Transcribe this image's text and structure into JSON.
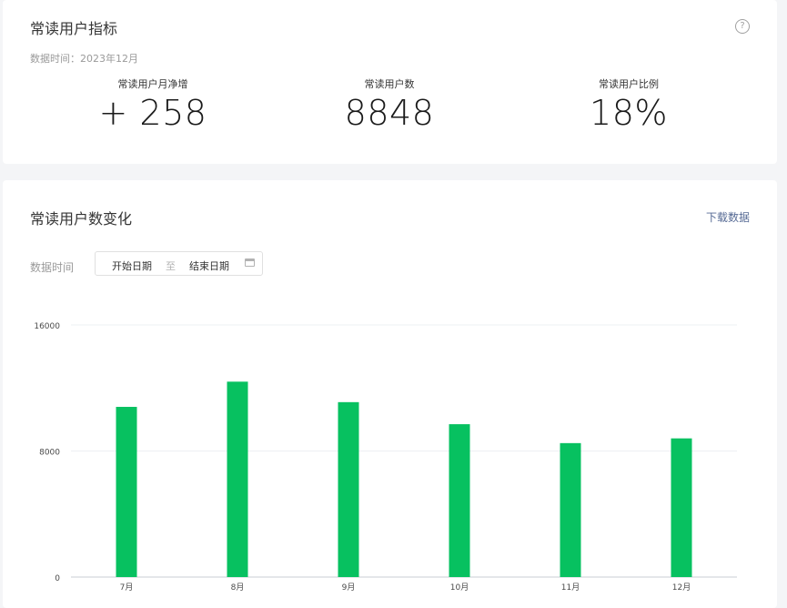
{
  "metrics_card": {
    "title": "常读用户指标",
    "help_icon": "?",
    "data_time": "数据时间：2023年12月",
    "metrics": [
      {
        "label": "常读用户月净增",
        "value": "+ 258"
      },
      {
        "label": "常读用户数",
        "value": "8848"
      },
      {
        "label": "常读用户比例",
        "value": "18%"
      }
    ]
  },
  "trend_card": {
    "title": "常读用户数变化",
    "download_label": "下载数据",
    "filter_label": "数据时间",
    "date_start_placeholder": "开始日期",
    "date_separator": "至",
    "date_end_placeholder": "结束日期"
  },
  "chart_data": {
    "type": "bar",
    "categories": [
      "7月",
      "8月",
      "9月",
      "10月",
      "11月",
      "12月"
    ],
    "values": [
      10800,
      12400,
      11100,
      9700,
      8500,
      8800
    ],
    "y_ticks": [
      "0",
      "8000",
      "16000"
    ],
    "ylim": [
      0,
      16000
    ],
    "grid": true,
    "bar_color": "#07c160"
  }
}
